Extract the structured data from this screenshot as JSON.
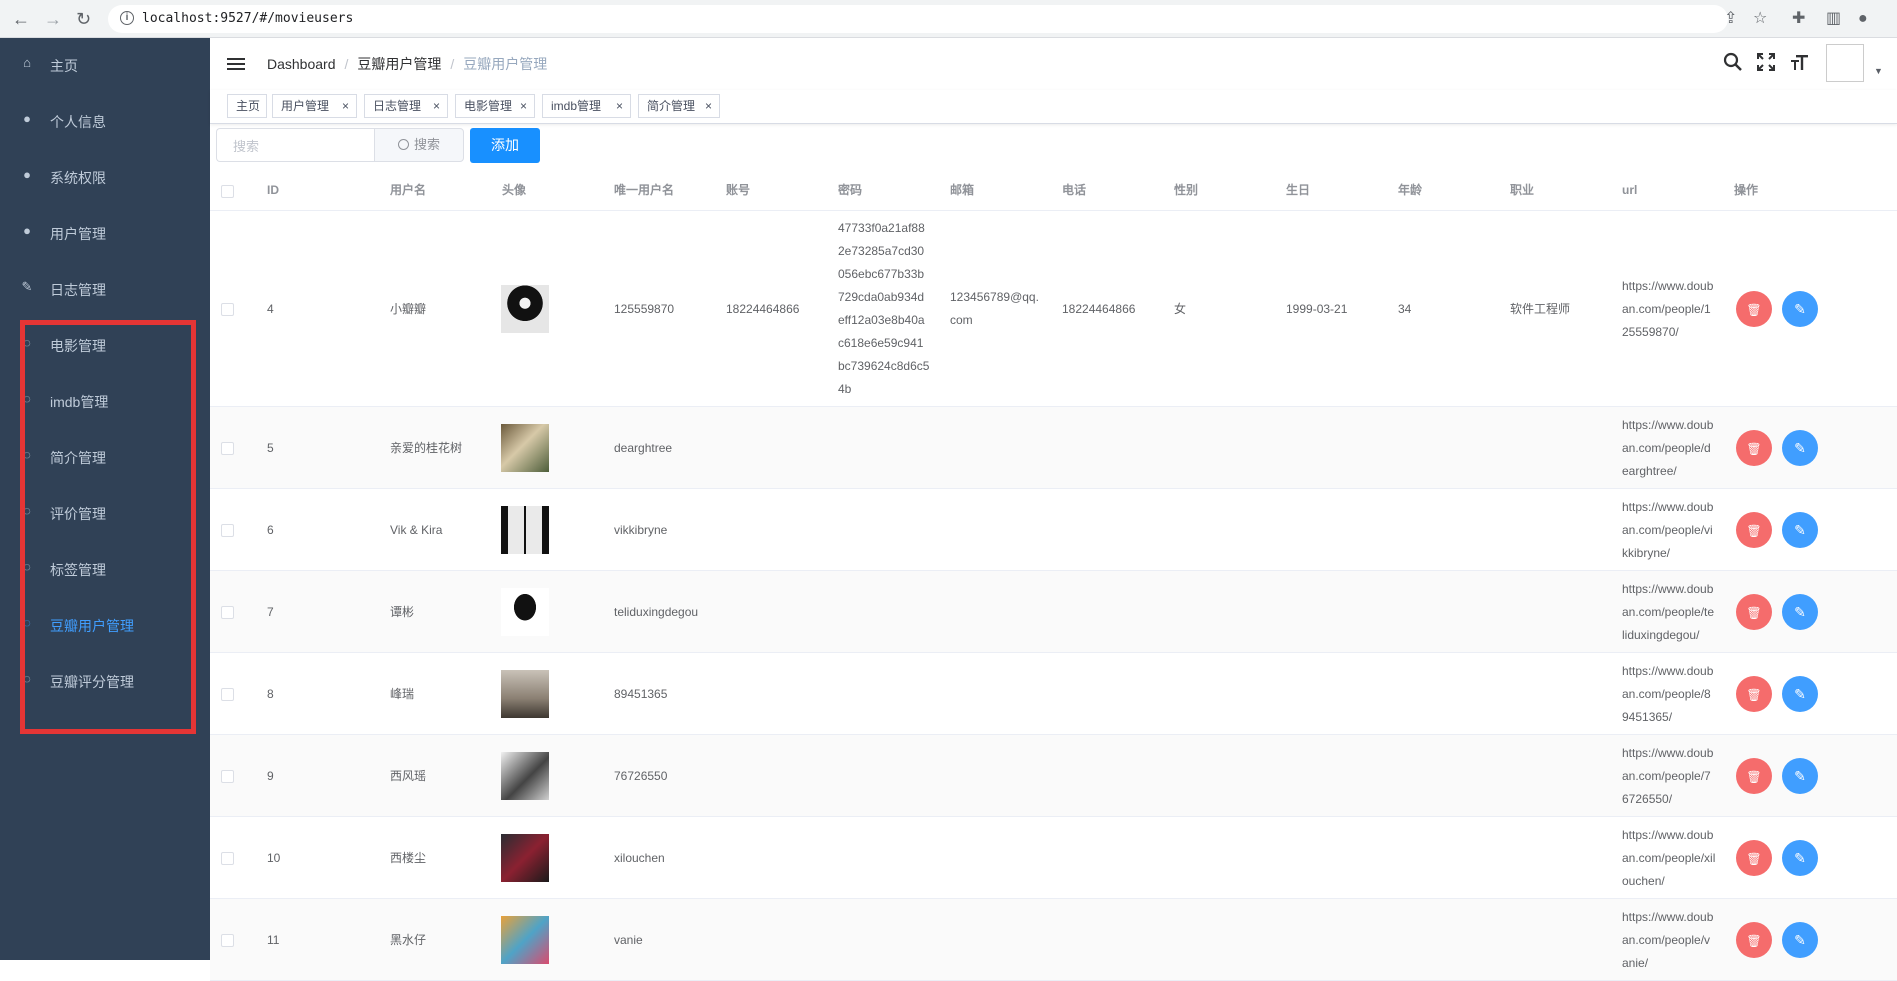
{
  "browser": {
    "url": "localhost:9527/#/movieusers",
    "back_icon": "←",
    "forward_icon": "→",
    "reload_icon": "↻",
    "info_icon": "i"
  },
  "sidebar": {
    "items": [
      {
        "label": "主页",
        "icon": "⌂"
      },
      {
        "label": "个人信息",
        "icon": "●"
      },
      {
        "label": "系统权限",
        "icon": "●"
      },
      {
        "label": "用户管理",
        "icon": "●"
      },
      {
        "label": "日志管理",
        "icon": "✎"
      },
      {
        "label": "电影管理",
        "icon": "◌"
      },
      {
        "label": "imdb管理",
        "icon": "◌"
      },
      {
        "label": "简介管理",
        "icon": "◌"
      },
      {
        "label": "评价管理",
        "icon": "◌"
      },
      {
        "label": "标签管理",
        "icon": "◌"
      },
      {
        "label": "豆瓣用户管理",
        "icon": "◌"
      },
      {
        "label": "豆瓣评分管理",
        "icon": "◌"
      }
    ],
    "active_index": 10
  },
  "header": {
    "breadcrumb": [
      "Dashboard",
      "豆瓣用户管理",
      "豆瓣用户管理"
    ],
    "icons": {
      "search": "⚲",
      "fullscreen": "⛶",
      "size": "T"
    }
  },
  "tags": [
    {
      "label": "主页",
      "closable": false
    },
    {
      "label": "用户管理",
      "closable": true
    },
    {
      "label": "日志管理",
      "closable": true
    },
    {
      "label": "电影管理",
      "closable": true
    },
    {
      "label": "imdb管理",
      "closable": true
    },
    {
      "label": "简介管理",
      "closable": true
    }
  ],
  "toolbar": {
    "search_placeholder": "搜索",
    "search_button": "搜索",
    "add_button": "添加"
  },
  "table": {
    "columns": [
      "ID",
      "用户名",
      "头像",
      "唯一用户名",
      "账号",
      "密码",
      "邮箱",
      "电话",
      "性别",
      "生日",
      "年龄",
      "职业",
      "url",
      "操作"
    ],
    "rows": [
      {
        "id": "4",
        "username": "小瓣瓣",
        "unique": "125559870",
        "account": "18224464866",
        "password": "47733f0a21af882e73285a7cd30056ebc677b33b729cda0ab934deff12a03e8b40ac618e6e59c941bc739624c8d6c54b",
        "email": "123456789@qq.com",
        "phone": "18224464866",
        "gender": "女",
        "birthday": "1999-03-21",
        "age": "34",
        "job": "软件工程师",
        "url": "https://www.douban.com/people/125559870/"
      },
      {
        "id": "5",
        "username": "亲爱的桂花树",
        "unique": "dearghtree",
        "account": "",
        "password": "",
        "email": "",
        "phone": "",
        "gender": "",
        "birthday": "",
        "age": "",
        "job": "",
        "url": "https://www.douban.com/people/dearghtree/"
      },
      {
        "id": "6",
        "username": "Vik & Kira",
        "unique": "vikkibryne",
        "account": "",
        "password": "",
        "email": "",
        "phone": "",
        "gender": "",
        "birthday": "",
        "age": "",
        "job": "",
        "url": "https://www.douban.com/people/vikkibryne/"
      },
      {
        "id": "7",
        "username": "谭彬",
        "unique": "teliduxingdegou",
        "account": "",
        "password": "",
        "email": "",
        "phone": "",
        "gender": "",
        "birthday": "",
        "age": "",
        "job": "",
        "url": "https://www.douban.com/people/teliduxingdegou/"
      },
      {
        "id": "8",
        "username": "峰瑞",
        "unique": "89451365",
        "account": "",
        "password": "",
        "email": "",
        "phone": "",
        "gender": "",
        "birthday": "",
        "age": "",
        "job": "",
        "url": "https://www.douban.com/people/89451365/"
      },
      {
        "id": "9",
        "username": "西风瑶",
        "unique": "76726550",
        "account": "",
        "password": "",
        "email": "",
        "phone": "",
        "gender": "",
        "birthday": "",
        "age": "",
        "job": "",
        "url": "https://www.douban.com/people/76726550/"
      },
      {
        "id": "10",
        "username": "西楼尘",
        "unique": "xilouchen",
        "account": "",
        "password": "",
        "email": "",
        "phone": "",
        "gender": "",
        "birthday": "",
        "age": "",
        "job": "",
        "url": "https://www.douban.com/people/xilouchen/"
      },
      {
        "id": "11",
        "username": "黑水仔",
        "unique": "vanie",
        "account": "",
        "password": "",
        "email": "",
        "phone": "",
        "gender": "",
        "birthday": "",
        "age": "",
        "job": "",
        "url": "https://www.douban.com/people/vanie/"
      }
    ],
    "delete_icon": "🗑",
    "edit_icon": "✎"
  },
  "colors": {
    "sidebar_bg": "#304156",
    "sidebar_text": "#bfcbd9",
    "active": "#409eff",
    "primary": "#1890ff",
    "danger": "#f56c6c",
    "highlight_box": "#e53535"
  }
}
